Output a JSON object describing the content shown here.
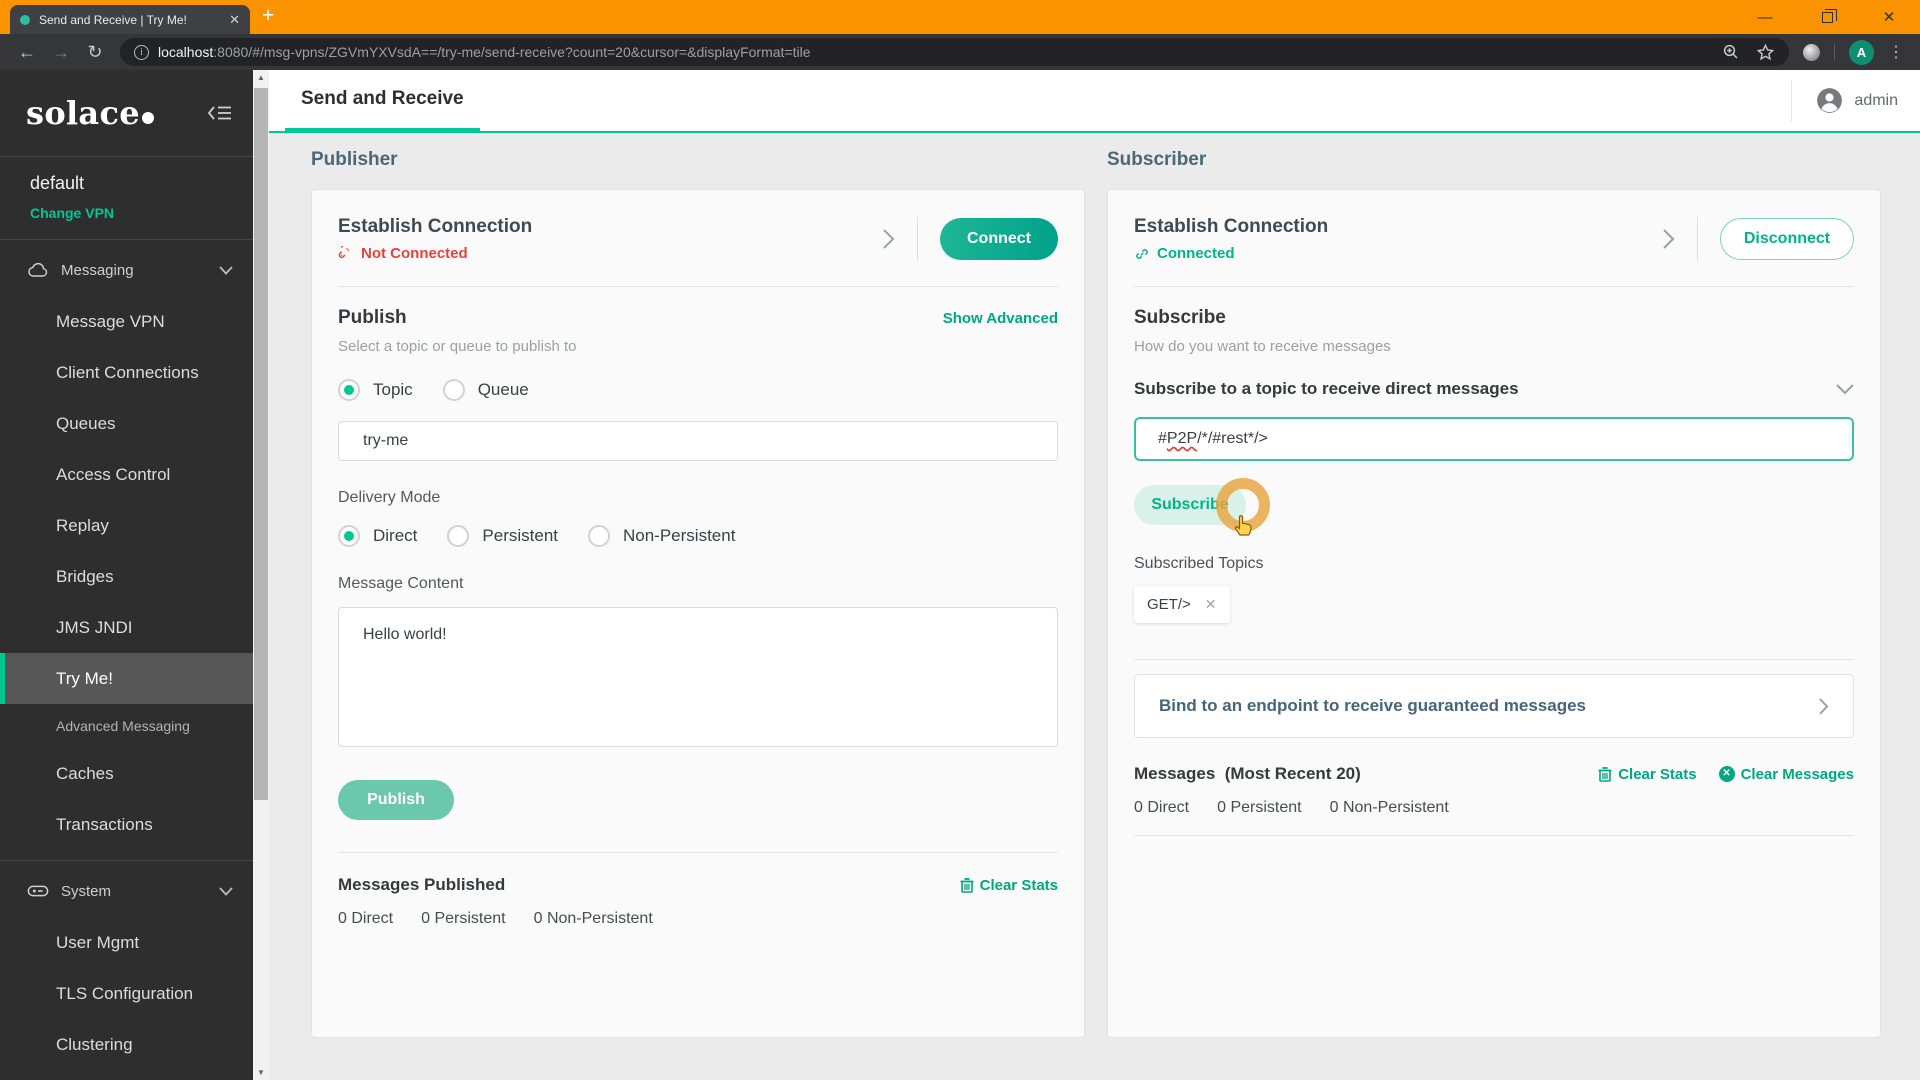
{
  "colors": {
    "accent": "#00c895",
    "accent_link": "#00a87f",
    "frame_orange": "#fb9300",
    "error_red": "#e5423c",
    "heading_slate": "#4b6878"
  },
  "browser": {
    "tab_title": "Send and Receive | Try Me!",
    "url_host": "localhost",
    "url_rest": ":8080/#/msg-vpns/ZGVmYXVsdA==/try-me/send-receive?count=20&cursor=&displayFormat=tile",
    "avatar_letter": "A"
  },
  "sidebar": {
    "logo": "solace",
    "vpn_name": "default",
    "change_vpn": "Change VPN",
    "messaging_label": "Messaging",
    "system_label": "System",
    "items": [
      {
        "label": "Message VPN"
      },
      {
        "label": "Client Connections"
      },
      {
        "label": "Queues"
      },
      {
        "label": "Access Control"
      },
      {
        "label": "Replay"
      },
      {
        "label": "Bridges"
      },
      {
        "label": "JMS JNDI"
      },
      {
        "label": "Try Me!"
      },
      {
        "label": "Advanced Messaging"
      },
      {
        "label": "Caches"
      },
      {
        "label": "Transactions"
      },
      {
        "label": "User Mgmt"
      },
      {
        "label": "TLS Configuration"
      },
      {
        "label": "Clustering"
      }
    ]
  },
  "header": {
    "page_tab": "Send and Receive",
    "user": "admin"
  },
  "publisher": {
    "heading": "Publisher",
    "connection": {
      "title": "Establish Connection",
      "status": "Not Connected",
      "action": "Connect"
    },
    "publish": {
      "heading": "Publish",
      "show_advanced": "Show Advanced",
      "hint": "Select a topic or queue to publish to",
      "topic_label": "Topic",
      "queue_label": "Queue",
      "topic_value": "try-me",
      "delivery_label": "Delivery Mode",
      "mode_direct": "Direct",
      "mode_persistent": "Persistent",
      "mode_non_persistent": "Non-Persistent",
      "message_label": "Message Content",
      "message_value": "Hello world!",
      "publish_button": "Publish"
    },
    "stats": {
      "title": "Messages Published",
      "clear_stats": "Clear Stats",
      "direct": "0 Direct",
      "persistent": "0 Persistent",
      "non_persistent": "0 Non-Persistent"
    }
  },
  "subscriber": {
    "heading": "Subscriber",
    "connection": {
      "title": "Establish Connection",
      "status": "Connected",
      "action": "Disconnect"
    },
    "subscribe": {
      "heading": "Subscribe",
      "hint": "How do you want to receive messages",
      "mode_label": "Subscribe to a topic to receive direct messages",
      "topic_part1": "#",
      "topic_part2": "P2P",
      "topic_part3": "/*/#rest*/>",
      "button": "Subscribe",
      "topics_label": "Subscribed Topics",
      "chip": "GET/>"
    },
    "bind_label": "Bind to an endpoint to receive guaranteed messages",
    "messages": {
      "title": "Messages",
      "recent": "(Most Recent 20)",
      "clear_stats": "Clear Stats",
      "clear_messages": "Clear Messages",
      "direct": "0 Direct",
      "persistent": "0 Persistent",
      "non_persistent": "0 Non-Persistent"
    }
  }
}
